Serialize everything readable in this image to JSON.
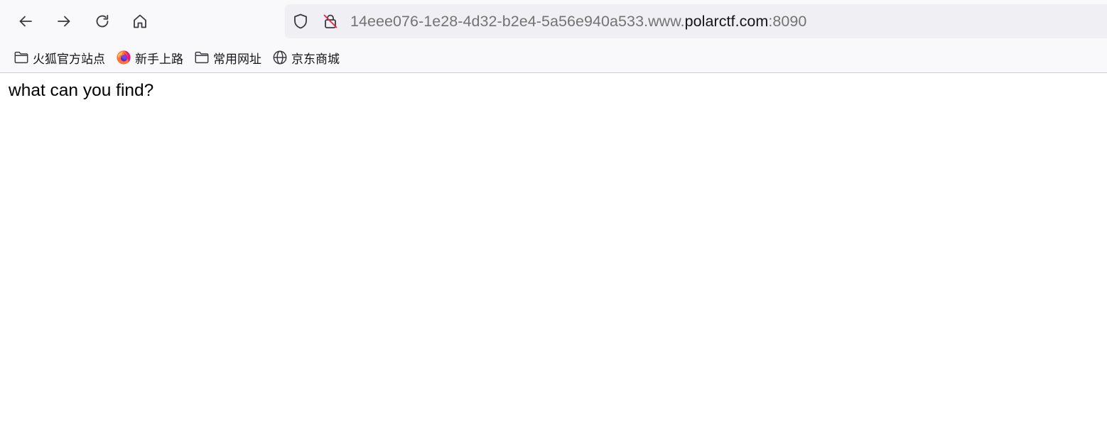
{
  "toolbar": {
    "back_icon": "arrow-left-icon",
    "forward_icon": "arrow-right-icon",
    "reload_icon": "reload-icon",
    "home_icon": "home-icon"
  },
  "urlbar": {
    "prefix": "14eee076-1e28-4d32-b2e4-5a56e940a533.www.",
    "domain": "polarctf.com",
    "port": ":8090",
    "shield_icon": "shield-icon",
    "insecure_icon": "insecure-lock-icon"
  },
  "bookmarks": [
    {
      "label": "火狐官方站点",
      "icon": "folder-icon"
    },
    {
      "label": "新手上路",
      "icon": "firefox-icon"
    },
    {
      "label": "常用网址",
      "icon": "folder-icon"
    },
    {
      "label": "京东商城",
      "icon": "globe-icon"
    }
  ],
  "page": {
    "text": "what can you find?"
  },
  "colors": {
    "chrome_bg": "#f9f9fb",
    "urlbar_bg": "#f0f0f4",
    "url_dim": "#737373",
    "url_domain": "#15141a"
  }
}
